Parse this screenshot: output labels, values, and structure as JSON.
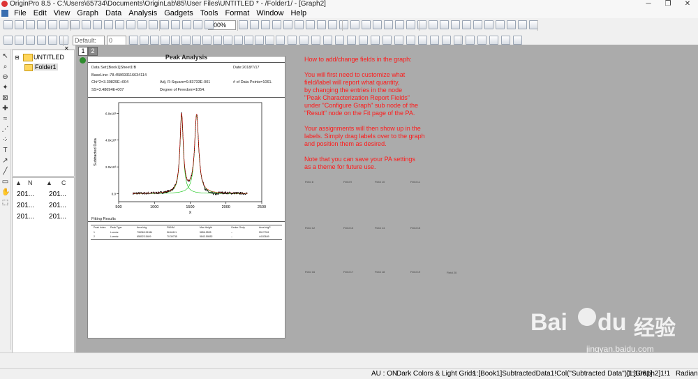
{
  "window": {
    "title": "OriginPro 8.5 - C:\\Users\\65734\\Documents\\OriginLab\\85\\User Files\\UNTITLED * - /Folder1/ - [Graph2]"
  },
  "menu": [
    "File",
    "Edit",
    "View",
    "Graph",
    "Data",
    "Analysis",
    "Gadgets",
    "Tools",
    "Format",
    "Window",
    "Help"
  ],
  "toolbar": {
    "zoom": "100%",
    "font": "Default:",
    "font_size": "0"
  },
  "project_explorer": {
    "root": "UNTITLED",
    "folder": "Folder1"
  },
  "pe_list": {
    "headers": [
      "N",
      "C"
    ],
    "rows": [
      [
        "201...",
        "201..."
      ],
      [
        "201...",
        "201..."
      ],
      [
        "201...",
        "201..."
      ]
    ]
  },
  "page_tabs": [
    "1",
    "2"
  ],
  "report": {
    "title": "Peak Analysis",
    "dataset": "Data Set:[Book1]Sheet1!B",
    "date": "Date:2018/7/17",
    "baseline": "BaseLine:-78.458693116634114",
    "chi2": "Chi^2=3.30829E+004",
    "adj_r2": "Adj. R-Square=9.83733E-001",
    "npoints": "# of Data Points=1061.",
    "ss": "SS=3.48694E+007",
    "dof": "Degree of Freedom=1054.",
    "fitting_results": "Fitting Results",
    "table_headers": [
      "Peak Index",
      "Peak Type",
      "Area Intg",
      "FWHM",
      "Max Height",
      "Center Grvty",
      "Area IntgP"
    ],
    "table_rows": [
      [
        "1",
        "Lorentz",
        "798369.51184",
        "56.64111",
        "5856.5535",
        "--",
        "55.27391"
      ],
      [
        "2",
        "Lorentz",
        "658023.5409",
        "70.39738",
        "5843.59552",
        "--",
        "44.82649"
      ]
    ]
  },
  "chart_data": {
    "type": "line",
    "title": "",
    "xlabel": "X",
    "ylabel": "Subtracted Data",
    "xlim": [
      500,
      2500
    ],
    "ylim": [
      -600,
      6800
    ],
    "x_ticks": [
      "500",
      "1000",
      "1500",
      "2000",
      "2500"
    ],
    "y_ticks": [
      "0.0",
      "2.0x10³",
      "4.0x10³",
      "6.0x10³"
    ],
    "peaks": [
      {
        "center": 1380,
        "height": 5850,
        "fwhm": 57
      },
      {
        "center": 1590,
        "height": 5840,
        "fwhm": 70
      }
    ],
    "series": [
      {
        "name": "",
        "color": "#000000"
      },
      {
        "name": "",
        "color": "#ff0000"
      },
      {
        "name": "",
        "color": "#00c000"
      }
    ]
  },
  "instructions": {
    "heading": "How to add/change fields in the graph:",
    "p1": "You will first need to customize what\nfield/label will report what quantity,\nby changing the entries in the node\n\"Peak Characterization Report Fields\"\nunder \"Configure Graph\" sub node of the\n\"Result\" node on the Fit page of the PA.",
    "p2": "Your assignments will then show up in the\nlabels. Simply drag labels over to the graph\nand position them as desired.",
    "p3": "Note that you can save your PA settings\nas a theme for future use."
  },
  "fields": [
    "Field 8",
    "Field 9",
    "Field 10",
    "Field 11",
    "Field 12",
    "Field 13",
    "Field 14",
    "Field 15",
    "Field 16",
    "Field 17",
    "Field 18",
    "Field 19",
    "Field 20"
  ],
  "status": {
    "au": "AU : ON",
    "theme": "Dark Colors & Light Grids",
    "data": "1:[Book1]SubtractedData1!Col(\"Subtracted Data\")[1:1061]",
    "graph": "1:[Graph2]1!1",
    "unit": "Radian"
  },
  "watermark": {
    "brand": "Bai",
    "brand2": "du",
    "cn": "经验",
    "url": "jingyan.baidu.com"
  },
  "colors": {
    "note": "#ff1a1a",
    "workspace": "#ababab"
  }
}
